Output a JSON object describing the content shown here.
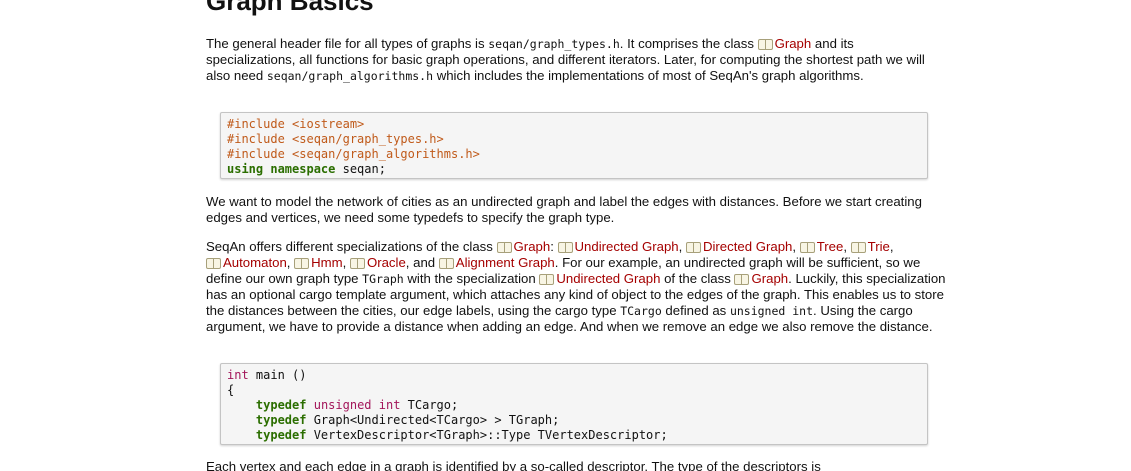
{
  "page": {
    "title": "Graph Basics"
  },
  "p1": {
    "t1": "The general header file for all types of graphs is ",
    "c1": "seqan/graph_types.h",
    "t2": ". It comprises the class ",
    "link_graph": "Graph",
    "t3": " and its specializations, all functions for basic graph operations, and different iterators. Later, for computing the shortest path we will also need ",
    "c2": "seqan/graph_algorithms.h",
    "t4": " which includes the implementations of most of SeqAn's graph algorithms."
  },
  "code1": {
    "l1": "#include <iostream>",
    "l2": "#include <seqan/graph_types.h>",
    "l3": "#include <seqan/graph_algorithms.h>",
    "l4_kw": "using namespace",
    "l4_rest": " seqan;"
  },
  "p2": {
    "text": "We want to model the network of cities as an undirected graph and label the edges with distances. Before we start creating edges and vertices, we need some typedefs to specify the graph type."
  },
  "p3": {
    "t1": "SeqAn offers different specializations of the class ",
    "link_graph": "Graph",
    "t2": ": ",
    "link_undirected": "Undirected Graph",
    "sep": ", ",
    "link_directed": "Directed Graph",
    "link_tree": "Tree",
    "link_trie": "Trie",
    "link_automaton": "Automaton",
    "link_hmm": "Hmm",
    "link_oracle": "Oracle",
    "t_and": ", and ",
    "link_alignment": "Alignment Graph",
    "t3": ". For our example, an undirected graph will be sufficient, so we define our own graph type ",
    "c_tgraph": "TGraph",
    "t4": " with the specialization ",
    "link_undirected2": "Undirected Graph",
    "t5": " of the class ",
    "link_graph2": "Graph",
    "t6": ". Luckily, this specialization has an optional cargo template argument, which attaches any kind of object to the edges of the graph. This enables us to store the distances between the cities, our edge labels, using the cargo type ",
    "c_tcargo": "TCargo",
    "t7": " defined as ",
    "c_unsigned": "unsigned int",
    "t8": ". Using the cargo argument, we have to provide a distance when adding an edge. And when we remove an edge we also remove the distance."
  },
  "code2": {
    "l1_ty": "int",
    "l1_rest": " main ()",
    "l2": "{",
    "l3_kw": "typedef",
    "l3_ty": "unsigned int",
    "l3_rest": " TCargo;",
    "l4_kw": "typedef",
    "l4_rest": " Graph<Undirected<TCargo> > TGraph;",
    "l5_kw": "typedef",
    "l5_rest": " VertexDescriptor<TGraph>::Type TVertexDescriptor;"
  },
  "p4": {
    "text": "Each vertex and each edge in a graph is identified by a so-called descriptor. The type of the descriptors is"
  },
  "colors": {
    "link": "#a50000",
    "preprocessor": "#c05a1a",
    "keyword": "#2b6e00",
    "type": "#a3165a",
    "code_bg": "#f5f5f5"
  },
  "icons": {
    "ref_icon": "book-icon"
  }
}
